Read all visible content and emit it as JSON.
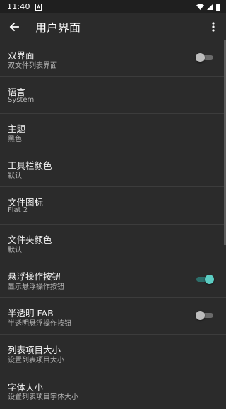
{
  "status": {
    "time": "11:40"
  },
  "appbar": {
    "title": "用户界面"
  },
  "settings": [
    {
      "title": "双界面",
      "subtitle": "双文件列表界面",
      "switch": "off"
    },
    {
      "title": "语言",
      "subtitle": "System"
    },
    {
      "title": "主题",
      "subtitle": "黑色"
    },
    {
      "title": "工具栏颜色",
      "subtitle": "默认"
    },
    {
      "title": "文件图标",
      "subtitle": "Flat 2"
    },
    {
      "title": "文件夹颜色",
      "subtitle": "默认"
    },
    {
      "title": "悬浮操作按钮",
      "subtitle": "显示悬浮操作按钮",
      "switch": "on"
    },
    {
      "title": "半透明 FAB",
      "subtitle": "半透明悬浮操作按钮",
      "switch": "off"
    },
    {
      "title": "列表项目大小",
      "subtitle": "设置列表项目大小"
    },
    {
      "title": "字体大小",
      "subtitle": "设置列表项目字体大小"
    }
  ],
  "colors": {
    "accent": "#5ccdc3",
    "background": "#2b2b2b"
  }
}
